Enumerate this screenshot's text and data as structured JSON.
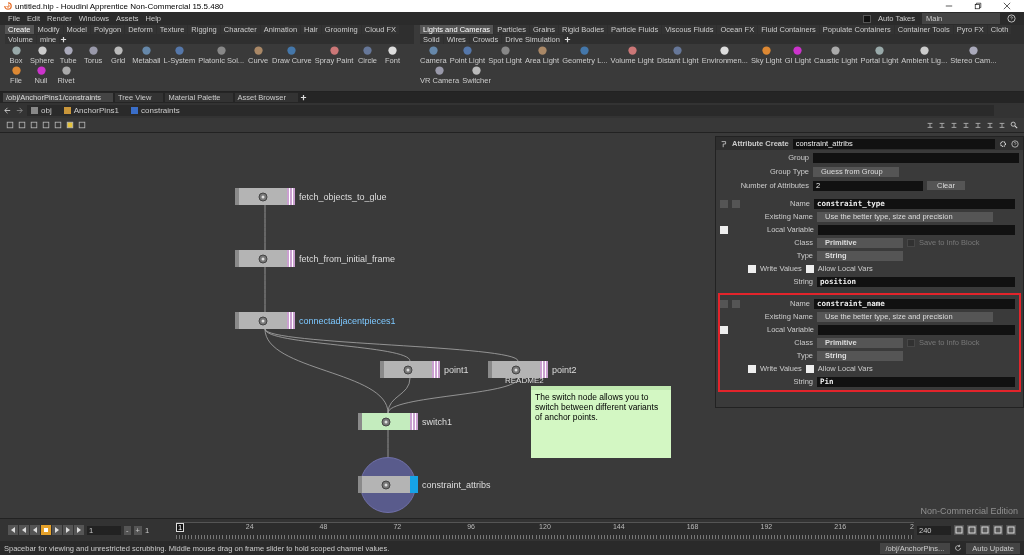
{
  "window": {
    "title": "untitled.hip - Houdini Apprentice Non-Commercial 15.5.480"
  },
  "menu": [
    "File",
    "Edit",
    "Render",
    "Windows",
    "Assets",
    "Help"
  ],
  "auto_takes": {
    "label": "Auto Takes",
    "checked": false
  },
  "take": "Main",
  "shelves": [
    {
      "tabs": [
        {
          "label": "Create",
          "selected": true
        },
        {
          "label": "Modify",
          "selected": false
        },
        {
          "label": "Model",
          "selected": false
        },
        {
          "label": "Polygon",
          "selected": false
        },
        {
          "label": "Deform",
          "selected": false
        },
        {
          "label": "Texture",
          "selected": false
        },
        {
          "label": "Rigging",
          "selected": false
        },
        {
          "label": "Character",
          "selected": false
        },
        {
          "label": "Animation",
          "selected": false
        },
        {
          "label": "Hair",
          "selected": false
        },
        {
          "label": "Grooming",
          "selected": false
        },
        {
          "label": "Cloud FX",
          "selected": false
        },
        {
          "label": "Volume",
          "selected": false
        },
        {
          "label": "mine",
          "selected": false
        }
      ],
      "tools": [
        "Box",
        "Sphere",
        "Tube",
        "Torus",
        "Grid",
        "Metaball",
        "L-System",
        "Platonic Sol...",
        "Curve",
        "Draw Curve",
        "Spray Paint",
        "Circle",
        "Font",
        "File",
        "Null",
        "Rivet"
      ]
    },
    {
      "tabs": [
        {
          "label": "Lights and Cameras",
          "selected": true
        },
        {
          "label": "Particles",
          "selected": false
        },
        {
          "label": "Grains",
          "selected": false
        },
        {
          "label": "Rigid Bodies",
          "selected": false
        },
        {
          "label": "Particle Fluids",
          "selected": false
        },
        {
          "label": "Viscous Fluids",
          "selected": false
        },
        {
          "label": "Ocean FX",
          "selected": false
        },
        {
          "label": "Fluid Containers",
          "selected": false
        },
        {
          "label": "Populate Containers",
          "selected": false
        },
        {
          "label": "Container Tools",
          "selected": false
        },
        {
          "label": "Pyro FX",
          "selected": false
        },
        {
          "label": "Cloth",
          "selected": false
        },
        {
          "label": "Solid",
          "selected": false
        },
        {
          "label": "Wires",
          "selected": false
        },
        {
          "label": "Crowds",
          "selected": false
        },
        {
          "label": "Drive Simulation",
          "selected": false
        }
      ],
      "tools": [
        "Camera",
        "Point Light",
        "Spot Light",
        "Area Light",
        "Geometry L...",
        "Volume Light",
        "Distant Light",
        "Environmen...",
        "Sky Light",
        "GI Light",
        "Caustic Light",
        "Portal Light",
        "Ambient Lig...",
        "Stereo Cam...",
        "VR Camera",
        "Switcher"
      ]
    }
  ],
  "pane_tabs": [
    {
      "label": "/obj/AnchorPins1/constraints",
      "selected": true
    },
    {
      "label": "Tree View",
      "selected": false
    },
    {
      "label": "Material Palette",
      "selected": false
    },
    {
      "label": "Asset Browser",
      "selected": false
    }
  ],
  "path": [
    "obj",
    "AnchorPins1",
    "constraints"
  ],
  "network": {
    "nodes": [
      {
        "name": "fetch_objects_to_glue",
        "color": "#b4b4b4",
        "selected": false,
        "display": false
      },
      {
        "name": "fetch_from_initial_frame",
        "color": "#b4b4b4",
        "selected": false,
        "display": false
      },
      {
        "name": "connectadjacentpieces1",
        "color": "#b4b4b4",
        "selected": true,
        "display": false
      },
      {
        "name": "point1",
        "color": "#b4b4b4",
        "selected": false,
        "display": false
      },
      {
        "name": "point2",
        "color": "#b4b4b4",
        "selected": false,
        "display": false
      },
      {
        "name": "switch1",
        "color": "#c4ecbe",
        "selected": false,
        "display": false
      },
      {
        "name": "constraint_attribs",
        "color": "#b4b4b4",
        "selected": false,
        "display": true
      }
    ],
    "sticky": {
      "title": "README2",
      "text": "The switch node allows you to switch between different variants of anchor points."
    },
    "watermark": "Non-Commercial Edition"
  },
  "params": {
    "type": "Attribute Create",
    "node_name": "constraint_attribs",
    "group_label": "Group",
    "group_type_label": "Group Type",
    "group_type": "Guess from Group",
    "count_label": "Number of Attributes",
    "count": "2",
    "clear": "Clear",
    "attributes": [
      {
        "highlighted": false,
        "name_label": "Name",
        "name": "constraint_type",
        "existing_label": "Existing Name",
        "existing": "Use the better type, size and precision",
        "local_label": "Local Variable",
        "local_checked": true,
        "class_label": "Class",
        "class": "Primitive",
        "info_label": "Save to Info Block",
        "info_checked": false,
        "type_label": "Type",
        "type": "String",
        "write_label": "Write Values",
        "write_checked": true,
        "allow_label": "Allow Local Vars",
        "allow_checked": true,
        "string_label": "String",
        "string": "position"
      },
      {
        "highlighted": true,
        "name_label": "Name",
        "name": "constraint_name",
        "existing_label": "Existing Name",
        "existing": "Use the better type, size and precision",
        "local_label": "Local Variable",
        "local_checked": true,
        "class_label": "Class",
        "class": "Primitive",
        "info_label": "Save to Info Block",
        "info_checked": false,
        "type_label": "Type",
        "type": "String",
        "write_label": "Write Values",
        "write_checked": true,
        "allow_label": "Allow Local Vars",
        "allow_checked": true,
        "string_label": "String",
        "string": "Pin"
      }
    ]
  },
  "timeline": {
    "start": "1",
    "minus": "-",
    "plus": "+",
    "start_frame": "1",
    "current": "1",
    "ticks": [
      "24",
      "48",
      "72",
      "96",
      "120",
      "144",
      "168",
      "192",
      "216",
      "2"
    ],
    "end": "240",
    "level": 0
  },
  "status": {
    "message": "Spacebar for viewing and unrestricted scrubbing. Middle mouse drag on frame slider to hold scoped channel values.",
    "path": "/obj/AnchorPins...",
    "update": "Auto Update"
  }
}
